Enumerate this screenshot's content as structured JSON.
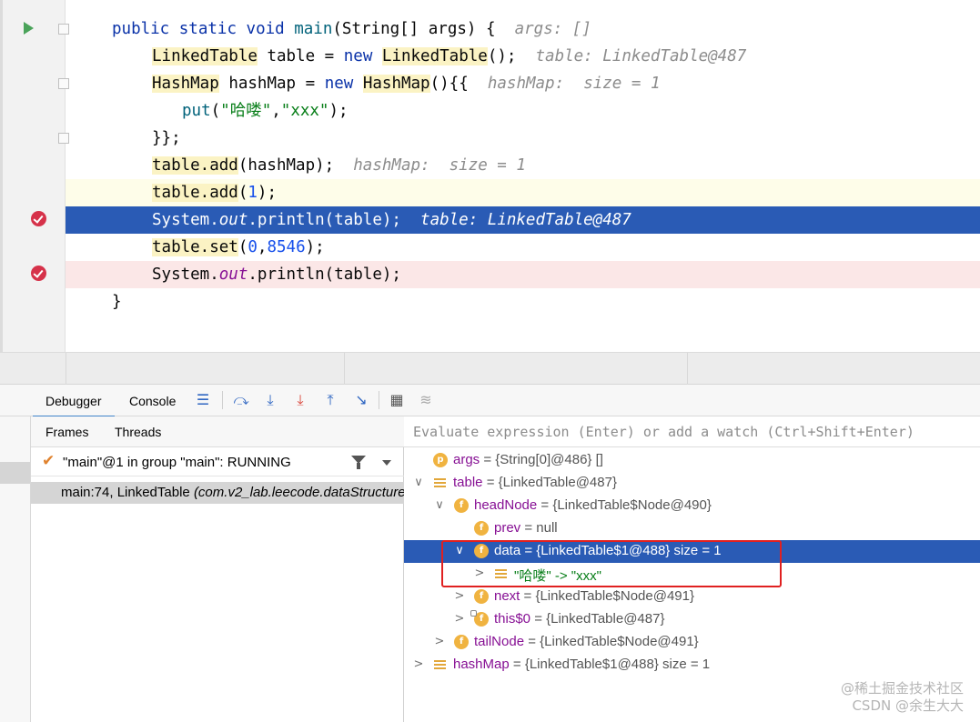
{
  "editor": {
    "lines": [
      {
        "kind": "header",
        "hint": "args: []"
      },
      {
        "kind": "decl1",
        "hint": "table: LinkedTable@487"
      },
      {
        "kind": "decl2",
        "hint": "hashMap:  size = 1"
      },
      {
        "kind": "put"
      },
      {
        "kind": "close"
      },
      {
        "kind": "add1",
        "hint": "hashMap:  size = 1"
      },
      {
        "kind": "add2"
      },
      {
        "kind": "print1",
        "hint": "table: LinkedTable@487"
      },
      {
        "kind": "set"
      },
      {
        "kind": "print2"
      },
      {
        "kind": "end"
      }
    ],
    "tokens": {
      "public": "public",
      "static": "static",
      "void": "void",
      "main": "main",
      "params": "(String[] args) {",
      "LinkedTable": "LinkedTable",
      "table": "table",
      "eq": " = ",
      "new": "new",
      "ctor_end": "();",
      "HashMap": "HashMap",
      "hashMap": "hashMap",
      "map_ctor": "(){{",
      "put": "put",
      "put_open": "(",
      "put_key": "\"哈喽\"",
      "comma": ",",
      "put_val": "\"xxx\"",
      "put_close": ");",
      "close_block": "}};",
      "table_add": "table.add",
      "add_arg_map": "(hashMap);",
      "paren_open": "(",
      "one": "1",
      "paren_close": ");",
      "System": "System.",
      "out": "out",
      "println": ".println(table);",
      "table_set": "table.set",
      "zero": "0",
      "set_val": "8546",
      "brace": "}"
    }
  },
  "debugger": {
    "tabs": [
      "Debugger",
      "Console"
    ],
    "subtabs": [
      "Frames",
      "Threads"
    ],
    "thread": "\"main\"@1 in group \"main\": RUNNING",
    "frame_loc": "main:74, LinkedTable ",
    "frame_pkg": "(com.v2_lab.leecode.dataStructure",
    "eval_placeholder": "Evaluate expression (Enter) or add a watch (Ctrl+Shift+Enter)",
    "variables": [
      {
        "name": "args",
        "value": " = {String[0]@486} []",
        "icon": "p",
        "arrow": ""
      },
      {
        "name": "table",
        "value": " = {LinkedTable@487}",
        "icon": "list",
        "arrow": "∨"
      },
      {
        "name": "headNode",
        "value": " = {LinkedTable$Node@490}",
        "icon": "f",
        "arrow": "∨"
      },
      {
        "name": "prev",
        "value": " = null",
        "icon": "f",
        "arrow": ""
      },
      {
        "name": "data",
        "value": " = {LinkedTable$1@488}  size = 1",
        "icon": "f",
        "arrow": "∨"
      },
      {
        "name": "\"哈喽\"",
        "value": " -> \"xxx\"",
        "icon": "list",
        "arrow": ">"
      },
      {
        "name": "next",
        "value": " = {LinkedTable$Node@491}",
        "icon": "f",
        "arrow": ">"
      },
      {
        "name": "this$0",
        "value": " = {LinkedTable@487}",
        "icon": "f",
        "arrow": ">"
      },
      {
        "name": "tailNode",
        "value": " = {LinkedTable$Node@491}",
        "icon": "f",
        "arrow": ">"
      },
      {
        "name": "hashMap",
        "value": " = {LinkedTable$1@488}  size = 1",
        "icon": "list",
        "arrow": ">"
      }
    ]
  },
  "watermark": {
    "line1": "@稀土掘金技术社区",
    "line2": "CSDN @余生大大"
  }
}
